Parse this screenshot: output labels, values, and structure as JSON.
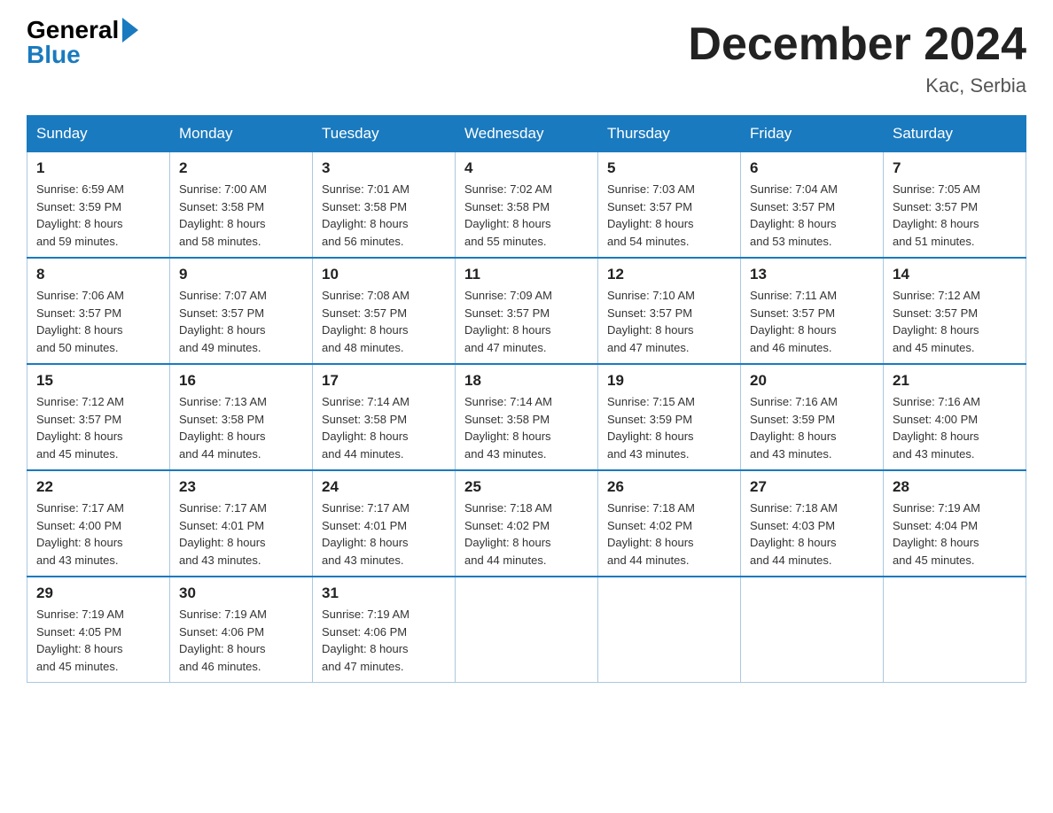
{
  "header": {
    "logo_general": "General",
    "logo_blue": "Blue",
    "title": "December 2024",
    "subtitle": "Kac, Serbia"
  },
  "weekdays": [
    "Sunday",
    "Monday",
    "Tuesday",
    "Wednesday",
    "Thursday",
    "Friday",
    "Saturday"
  ],
  "weeks": [
    [
      {
        "day": "1",
        "sunrise": "6:59 AM",
        "sunset": "3:59 PM",
        "daylight": "8 hours and 59 minutes."
      },
      {
        "day": "2",
        "sunrise": "7:00 AM",
        "sunset": "3:58 PM",
        "daylight": "8 hours and 58 minutes."
      },
      {
        "day": "3",
        "sunrise": "7:01 AM",
        "sunset": "3:58 PM",
        "daylight": "8 hours and 56 minutes."
      },
      {
        "day": "4",
        "sunrise": "7:02 AM",
        "sunset": "3:58 PM",
        "daylight": "8 hours and 55 minutes."
      },
      {
        "day": "5",
        "sunrise": "7:03 AM",
        "sunset": "3:57 PM",
        "daylight": "8 hours and 54 minutes."
      },
      {
        "day": "6",
        "sunrise": "7:04 AM",
        "sunset": "3:57 PM",
        "daylight": "8 hours and 53 minutes."
      },
      {
        "day": "7",
        "sunrise": "7:05 AM",
        "sunset": "3:57 PM",
        "daylight": "8 hours and 51 minutes."
      }
    ],
    [
      {
        "day": "8",
        "sunrise": "7:06 AM",
        "sunset": "3:57 PM",
        "daylight": "8 hours and 50 minutes."
      },
      {
        "day": "9",
        "sunrise": "7:07 AM",
        "sunset": "3:57 PM",
        "daylight": "8 hours and 49 minutes."
      },
      {
        "day": "10",
        "sunrise": "7:08 AM",
        "sunset": "3:57 PM",
        "daylight": "8 hours and 48 minutes."
      },
      {
        "day": "11",
        "sunrise": "7:09 AM",
        "sunset": "3:57 PM",
        "daylight": "8 hours and 47 minutes."
      },
      {
        "day": "12",
        "sunrise": "7:10 AM",
        "sunset": "3:57 PM",
        "daylight": "8 hours and 47 minutes."
      },
      {
        "day": "13",
        "sunrise": "7:11 AM",
        "sunset": "3:57 PM",
        "daylight": "8 hours and 46 minutes."
      },
      {
        "day": "14",
        "sunrise": "7:12 AM",
        "sunset": "3:57 PM",
        "daylight": "8 hours and 45 minutes."
      }
    ],
    [
      {
        "day": "15",
        "sunrise": "7:12 AM",
        "sunset": "3:57 PM",
        "daylight": "8 hours and 45 minutes."
      },
      {
        "day": "16",
        "sunrise": "7:13 AM",
        "sunset": "3:58 PM",
        "daylight": "8 hours and 44 minutes."
      },
      {
        "day": "17",
        "sunrise": "7:14 AM",
        "sunset": "3:58 PM",
        "daylight": "8 hours and 44 minutes."
      },
      {
        "day": "18",
        "sunrise": "7:14 AM",
        "sunset": "3:58 PM",
        "daylight": "8 hours and 43 minutes."
      },
      {
        "day": "19",
        "sunrise": "7:15 AM",
        "sunset": "3:59 PM",
        "daylight": "8 hours and 43 minutes."
      },
      {
        "day": "20",
        "sunrise": "7:16 AM",
        "sunset": "3:59 PM",
        "daylight": "8 hours and 43 minutes."
      },
      {
        "day": "21",
        "sunrise": "7:16 AM",
        "sunset": "4:00 PM",
        "daylight": "8 hours and 43 minutes."
      }
    ],
    [
      {
        "day": "22",
        "sunrise": "7:17 AM",
        "sunset": "4:00 PM",
        "daylight": "8 hours and 43 minutes."
      },
      {
        "day": "23",
        "sunrise": "7:17 AM",
        "sunset": "4:01 PM",
        "daylight": "8 hours and 43 minutes."
      },
      {
        "day": "24",
        "sunrise": "7:17 AM",
        "sunset": "4:01 PM",
        "daylight": "8 hours and 43 minutes."
      },
      {
        "day": "25",
        "sunrise": "7:18 AM",
        "sunset": "4:02 PM",
        "daylight": "8 hours and 44 minutes."
      },
      {
        "day": "26",
        "sunrise": "7:18 AM",
        "sunset": "4:02 PM",
        "daylight": "8 hours and 44 minutes."
      },
      {
        "day": "27",
        "sunrise": "7:18 AM",
        "sunset": "4:03 PM",
        "daylight": "8 hours and 44 minutes."
      },
      {
        "day": "28",
        "sunrise": "7:19 AM",
        "sunset": "4:04 PM",
        "daylight": "8 hours and 45 minutes."
      }
    ],
    [
      {
        "day": "29",
        "sunrise": "7:19 AM",
        "sunset": "4:05 PM",
        "daylight": "8 hours and 45 minutes."
      },
      {
        "day": "30",
        "sunrise": "7:19 AM",
        "sunset": "4:06 PM",
        "daylight": "8 hours and 46 minutes."
      },
      {
        "day": "31",
        "sunrise": "7:19 AM",
        "sunset": "4:06 PM",
        "daylight": "8 hours and 47 minutes."
      },
      null,
      null,
      null,
      null
    ]
  ],
  "labels": {
    "sunrise": "Sunrise:",
    "sunset": "Sunset:",
    "daylight": "Daylight:"
  }
}
